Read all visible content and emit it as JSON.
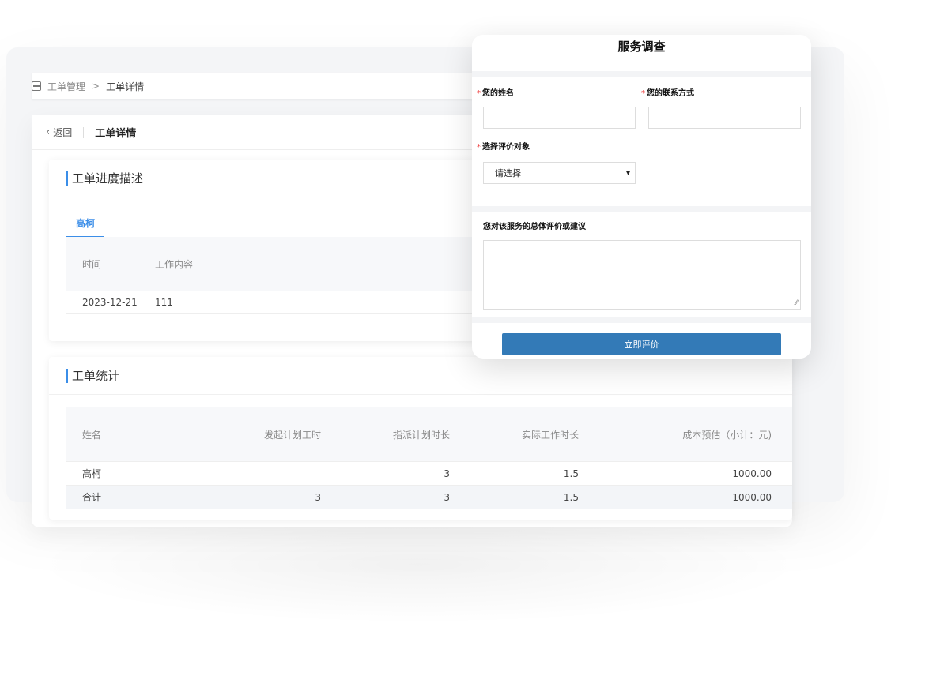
{
  "breadcrumb": {
    "parent": "工单管理",
    "separator": ">",
    "current": "工单详情"
  },
  "page_head": {
    "back_label": "返回",
    "title": "工单详情"
  },
  "progress_card": {
    "title": "工单进度描述",
    "tabs": [
      "高柯"
    ],
    "table": {
      "headers": [
        "时间",
        "工作内容"
      ],
      "rows": [
        [
          "2023-12-21",
          "111"
        ]
      ]
    }
  },
  "stats_card": {
    "title": "工单统计",
    "table": {
      "headers": [
        "姓名",
        "发起计划工时",
        "指派计划时长",
        "实际工作时长",
        "成本预估（小计：元)"
      ],
      "rows": [
        [
          "高柯",
          "",
          "3",
          "1.5",
          "1000.00"
        ],
        [
          "合计",
          "3",
          "3",
          "1.5",
          "1000.00"
        ]
      ]
    }
  },
  "survey": {
    "title": "服务调查",
    "name_label": "您的姓名",
    "contact_label": "您的联系方式",
    "target_label": "选择评价对象",
    "target_value": "请选择",
    "feedback_label": "您对该服务的总体评价或建议",
    "submit_label": "立即评价",
    "required_mark": "*"
  }
}
